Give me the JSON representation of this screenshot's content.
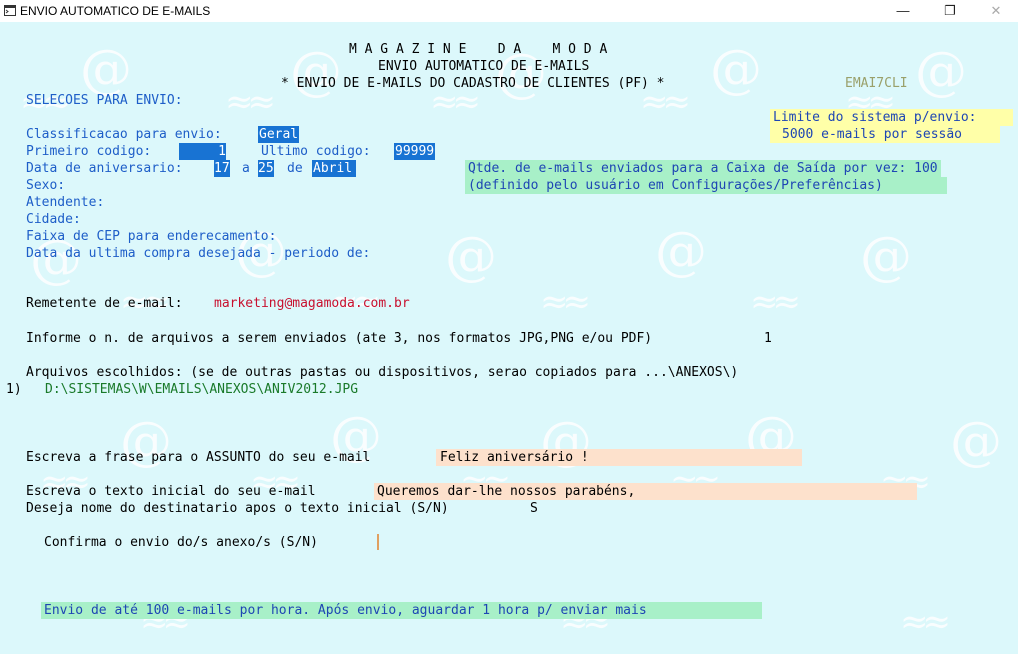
{
  "window": {
    "title": "ENVIO AUTOMATICO DE E-MAILS",
    "icon": "terminal-icon",
    "controls": [
      "minimize-icon",
      "maximize-icon",
      "close-icon"
    ]
  },
  "header": {
    "line1": "M A G A Z I N E    D A    M O D A",
    "line2": "ENVIO AUTOMATICO DE E-MAILS",
    "line3": "* ENVIO DE E-MAILS DO CADASTRO DE CLIENTES (PF) *",
    "code": "EMAI7CLI"
  },
  "selecoes_title": "SELECOES PARA ENVIO:",
  "limite": {
    "line1": "Limite do sistema p/envio:",
    "line2": "5000 e-mails por sessão"
  },
  "fields": {
    "classificacao_label": "Classificacao para envio:",
    "classificacao_value": "Geral",
    "primeiro_label": "Primeiro codigo:",
    "primeiro_value": "     1",
    "ultimo_label": "Ultimo codigo:",
    "ultimo_value": "99999",
    "data_aniv_label": "Data de aniversario:",
    "data_aniv_from": "17",
    "a_sep": "a",
    "data_aniv_to": "25",
    "de_sep": "de",
    "data_aniv_month": "Abril",
    "sexo_label": "Sexo:",
    "atendente_label": "Atendente:",
    "cidade_label": "Cidade:",
    "cep_label": "Faixa de CEP para enderecamento:",
    "ultima_compra_label": "Data da ultima compra desejada - periodo de:"
  },
  "qtde": {
    "line1": "Qtde. de e-mails enviados para a Caixa de Saída por vez: 100",
    "line2": "(definido pelo usuário em Configurações/Preferências)"
  },
  "remetente": {
    "label": "Remetente de e-mail:",
    "value": "marketing@magamoda.com.br"
  },
  "arquivos_n": {
    "label": "Informe o n. de arquivos a serem enviados (ate 3, nos formatos JPG,PNG e/ou PDF)",
    "value": "1"
  },
  "arquivos_escolhidos": {
    "label": "Arquivos escolhidos: (se de outras pastas ou dispositivos, serao copiados para ...\\ANEXOS\\)",
    "items": [
      {
        "num": "1)",
        "path": "D:\\SISTEMAS\\W\\EMAILS\\ANEXOS\\ANIV2012.JPG"
      }
    ]
  },
  "assunto": {
    "label": "Escreva a frase para o ASSUNTO do seu e-mail",
    "value": "Feliz aniversário !"
  },
  "texto_inicial": {
    "label": "Escreva o texto inicial do seu e-mail",
    "value": "Queremos dar-lhe nossos parabéns,"
  },
  "nome_dest": {
    "label": "Deseja nome do destinatario apos o texto inicial (S/N)",
    "value": "S"
  },
  "confirma": {
    "label": "Confirma o envio do/s anexo/s (S/N)",
    "value": ""
  },
  "footer": "Envio de até 100 e-mails por hora. Após envio, aguardar 1 hora p/ enviar mais"
}
